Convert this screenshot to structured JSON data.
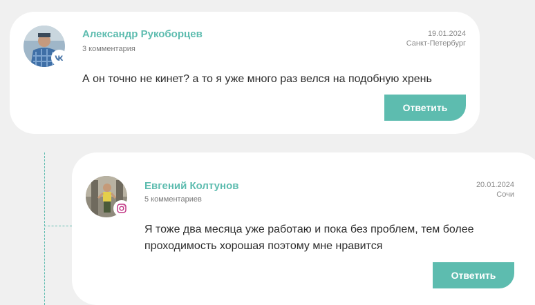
{
  "comments": [
    {
      "author": "Александр Рукоборцев",
      "count_label": "3 комментария",
      "date": "19.01.2024",
      "city": "Санкт-Петербург",
      "text": "А он точно не кинет? а то я уже много раз велся на подобную хрень",
      "reply_label": "Ответить",
      "source_icon": "vk-icon"
    },
    {
      "author": "Евгений Колтунов",
      "count_label": "5 комментариев",
      "date": "20.01.2024",
      "city": "Сочи",
      "text": "Я тоже два месяца уже работаю и пока без проблем, тем более проходимость хорошая поэтому мне нравится",
      "reply_label": "Ответить",
      "source_icon": "instagram-icon"
    }
  ],
  "colors": {
    "accent": "#5dbcaf",
    "background": "#f0f0f0",
    "card": "#ffffff",
    "vk": "#4a76a8",
    "instagram": "#c13584"
  }
}
